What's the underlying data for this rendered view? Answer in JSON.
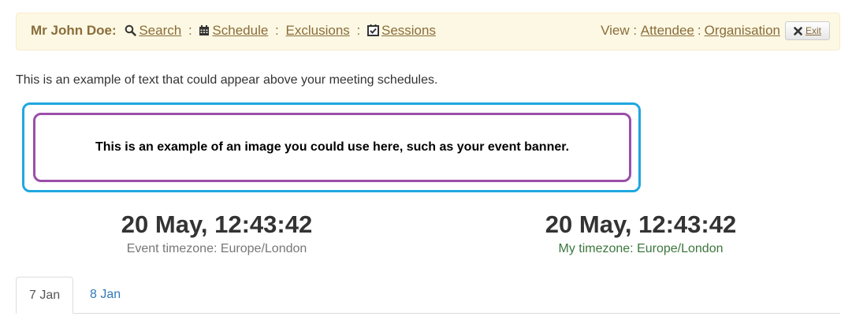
{
  "header": {
    "user_name": "Mr John Doe:",
    "nav": {
      "search": "Search",
      "schedule": "Schedule",
      "exclusions": "Exclusions",
      "sessions": "Sessions",
      "separator": ":"
    },
    "view_label": "View :",
    "view_links": {
      "attendee": "Attendee",
      "organisation": "Organisation",
      "separator": ":"
    },
    "exit_label": "Exit"
  },
  "intro_text": "This is an example of text that could appear above your meeting schedules.",
  "banner": {
    "text": "This is an example of an image you could use here, such as your event banner."
  },
  "clocks": {
    "event": {
      "time": "20 May, 12:43:42",
      "timezone": "Event timezone: Europe/London"
    },
    "mine": {
      "time": "20 May, 12:43:42",
      "timezone": "My timezone: Europe/London"
    }
  },
  "tabs": [
    {
      "label": "7 Jan",
      "active": true
    },
    {
      "label": "8 Jan",
      "active": false
    }
  ],
  "colors": {
    "header_bg": "#fcf8e3",
    "header_text": "#8a6d3b",
    "banner_outer": "#1fa7e0",
    "banner_inner": "#9b4ea9",
    "my_timezone": "#3c763d",
    "tab_link": "#337ab7"
  },
  "icons": {
    "search": "magnifier-icon",
    "schedule": "calendar-icon",
    "sessions": "checked-calendar-icon",
    "exit": "close-icon"
  }
}
